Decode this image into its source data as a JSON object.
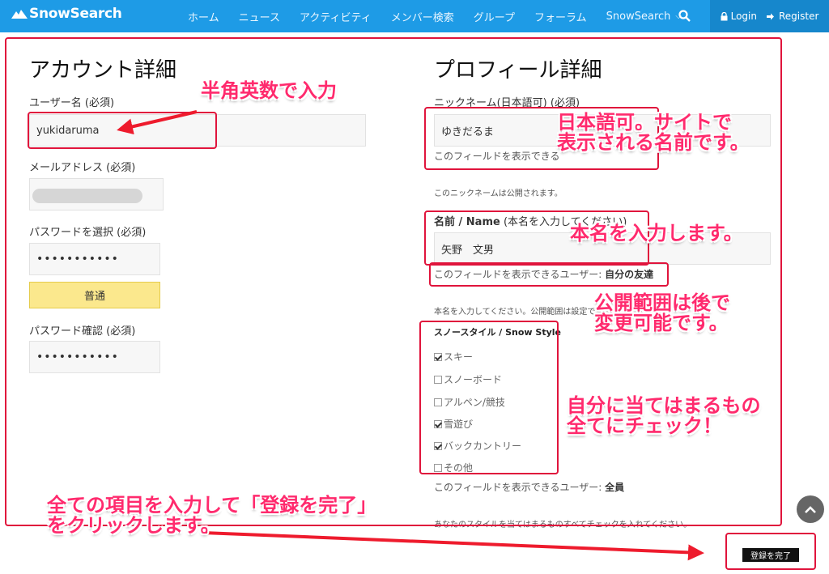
{
  "header": {
    "logo": "SnowSearch",
    "nav": [
      {
        "label": "ホーム"
      },
      {
        "label": "ニュース"
      },
      {
        "label": "アクティビティ"
      },
      {
        "label": "メンバー検索"
      },
      {
        "label": "グループ"
      },
      {
        "label": "フォーラム"
      },
      {
        "label": "SnowSearch"
      }
    ],
    "login": "Login",
    "register": "Register"
  },
  "account": {
    "title": "アカウント詳細",
    "username_label": "ユーザー名 (必須)",
    "username_value": "yukidaruma",
    "email_label": "メールアドレス (必須)",
    "password_label": "パスワードを選択 (必須)",
    "password_value": "•••••••••••",
    "strength": "普通",
    "confirm_label": "パスワード確認 (必須)",
    "confirm_value": "•••••••••••"
  },
  "profile": {
    "title": "プロフィール詳細",
    "nickname_label": "ニックネーム(日本語可) (必須)",
    "nickname_value": "ゆきだるま",
    "nickname_visibility": "このフィールドを表示できる",
    "nickname_note": "このニックネームは公開されます。",
    "name_label_bold": "名前 / Name",
    "name_label_rest": " (本名を入力してください)",
    "name_value": "矢野　文男",
    "visibility_prefix": "このフィールドを表示できるユーザー: ",
    "name_visibility_value": "自分の友達",
    "name_note": "本名を入力してください。公開範囲は設定で",
    "style_title": "スノースタイル / Snow Style",
    "styles": [
      {
        "label": "スキー",
        "checked": true
      },
      {
        "label": "スノーボード",
        "checked": false
      },
      {
        "label": "アルペン/競技",
        "checked": false
      },
      {
        "label": "雪遊び",
        "checked": true
      },
      {
        "label": "バックカントリー",
        "checked": true
      },
      {
        "label": "その他",
        "checked": false
      }
    ],
    "style_visibility_value": "全員",
    "style_note": "あなたのスタイルを当てはまるものすべてチェックを入れてください。"
  },
  "submit_label": "登録を完了",
  "annotations": {
    "a": "半角英数で入力",
    "b1": "日本語可。サイトで",
    "b2": "表示される名前です。",
    "c": "本名を入力します。",
    "d1": "公開範囲は後で",
    "d2": "変更可能です。",
    "e1": "自分に当てはまるもの",
    "e2": "全てにチェック！",
    "f1": "全ての項目を入力して「登録を完了」",
    "f2": "をクリックします。"
  },
  "colors": {
    "nav": "#1e9be6",
    "annotation": "#ff2a6d",
    "frame": "#e0143c",
    "strength": "#fbe88d"
  }
}
